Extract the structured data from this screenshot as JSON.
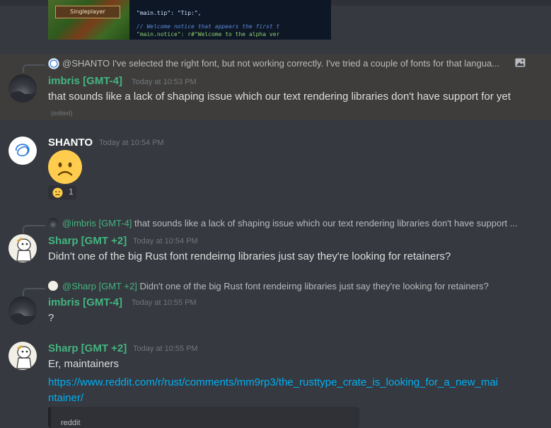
{
  "top_image": {
    "singleplayer_label": "Singleplayer",
    "code_lines": [
      "\"main.tip\": \"Tip:\",",
      "// Welcome notice that appears the first t",
      "\"main.notice\": r#\"Welcome to the alpha ver"
    ]
  },
  "messages": [
    {
      "reply_to_name": "@SHANTO",
      "reply_text": "I've selected the right font, but not working correctly. I've tried a couple of fonts for that langua...",
      "author": "imbris [GMT-4]",
      "timestamp": "Today at 10:53 PM",
      "text": "that sounds like a lack of shaping issue which our text rendering libraries don't have support for yet",
      "edited": "(edited)"
    },
    {
      "author": "SHANTO",
      "timestamp": "Today at 10:54 PM",
      "reaction_count": "1"
    },
    {
      "reply_to_name": "@imbris [GMT-4]",
      "reply_text": "that sounds like a lack of shaping issue which our text rendering libraries don't have support ...",
      "author": "Sharp [GMT +2]",
      "timestamp": "Today at 10:54 PM",
      "text": "Didn't one of the big Rust font rendeirng libraries just say they're looking for retainers?"
    },
    {
      "reply_to_name": "@Sharp [GMT +2]",
      "reply_text": "Didn't one of the big Rust font rendeirng libraries just say they're looking for retainers?",
      "author": "imbris [GMT-4]",
      "timestamp": "Today at 10:55 PM",
      "text": "?"
    },
    {
      "author": "Sharp [GMT +2]",
      "timestamp": "Today at 10:55 PM",
      "text": "Er, maintainers",
      "link_line1": "https://www.reddit.com/r/rust/comments/mm9rp3/the_rusttype_crate_is_looking_for_a_new_mai",
      "link_line2": "ntainer/",
      "embed_provider": "reddit"
    }
  ],
  "colors": {
    "background": "#36393f",
    "author_green": "#43b581",
    "link": "#00b0f4"
  },
  "icons": [
    "image-icon",
    "frowning-emoji",
    "avatar-imbris",
    "avatar-shanto",
    "avatar-sharp"
  ]
}
